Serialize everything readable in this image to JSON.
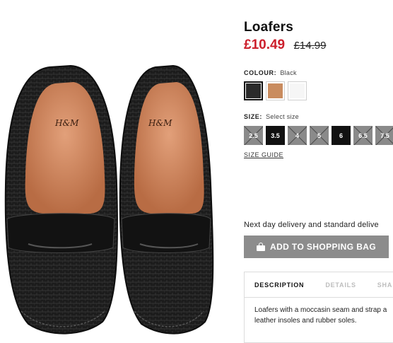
{
  "product": {
    "title": "Loafers",
    "price_now": "£10.49",
    "price_old": "£14.99",
    "brand_mark": "H&M"
  },
  "colour": {
    "label": "COLOUR:",
    "selected": "Black",
    "swatches": [
      {
        "name": "Black",
        "color": "#2a2a2a",
        "selected": true
      },
      {
        "name": "Tan",
        "color": "#c98c5f",
        "selected": false
      },
      {
        "name": "White",
        "color": "#f6f6f6",
        "selected": false
      }
    ]
  },
  "size": {
    "label": "SIZE:",
    "placeholder": "Select size",
    "options": [
      {
        "value": "2.5",
        "available": false
      },
      {
        "value": "3.5",
        "available": true
      },
      {
        "value": "4",
        "available": false
      },
      {
        "value": "5",
        "available": false
      },
      {
        "value": "6",
        "available": true
      },
      {
        "value": "6.5",
        "available": false
      },
      {
        "value": "7.5",
        "available": false
      }
    ],
    "guide_label": "SIZE GUIDE"
  },
  "delivery": {
    "text": "Next day delivery and standard delive"
  },
  "cart": {
    "add_label": "ADD TO SHOPPING BAG"
  },
  "description": {
    "tabs": [
      "DESCRIPTION",
      "DETAILS",
      "SHA"
    ],
    "active_tab": 0,
    "lines": [
      "Loafers with a moccasin seam and strap a",
      "leather insoles and rubber soles."
    ]
  }
}
